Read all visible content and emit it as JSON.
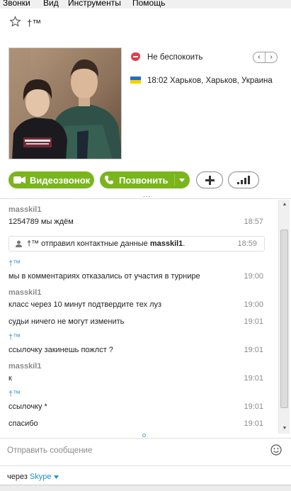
{
  "menu": [
    "Звонки",
    "Вид",
    "Инструменты",
    "Помощь"
  ],
  "header": {
    "contact_name": "†™"
  },
  "profile": {
    "status": "Не беспокоить",
    "local_time": "18:02",
    "location": "Харьков, Харьков, Украина"
  },
  "actions": {
    "video_call": "Видеозвонок",
    "call": "Позвонить",
    "more": "..."
  },
  "chat": {
    "messages": [
      {
        "sender": "masskil1",
        "text": "1254789 мы ждём",
        "time": "18:57"
      },
      {
        "system": true,
        "sender": "†™",
        "text_pre": " отправил контактные данные ",
        "contact": "masskil1",
        "text_post": ".",
        "time": "18:59"
      },
      {
        "sender": "†™",
        "text": "мы в комментариях отказались от участия в турнире",
        "time": "19:00"
      },
      {
        "sender": "masskil1",
        "text": "класс через 10 минут подтвердите тех луз",
        "time": "19:00"
      },
      {
        "text": "судьи ничего не могут изменить",
        "time": "19:01"
      },
      {
        "sender": "†™",
        "text": "ссылочку закинешь пожлст ?",
        "time": "19:01"
      },
      {
        "sender": "masskil1",
        "text": "к",
        "time": "19:01"
      },
      {
        "sender": "†™",
        "text": "ссылочку *",
        "time": "19:01"
      },
      {
        "text": "спасибо",
        "time": "19:01"
      }
    ]
  },
  "compose": {
    "placeholder": "Отправить сообщение"
  },
  "footer": {
    "via": "через",
    "service": "Skype"
  },
  "colors": {
    "green": "#7ab51d",
    "link": "#1a8fd0",
    "sender_gray": "#8a8a8a",
    "me_blue": "#3b8fd0",
    "status_red": "#e33b4a"
  }
}
